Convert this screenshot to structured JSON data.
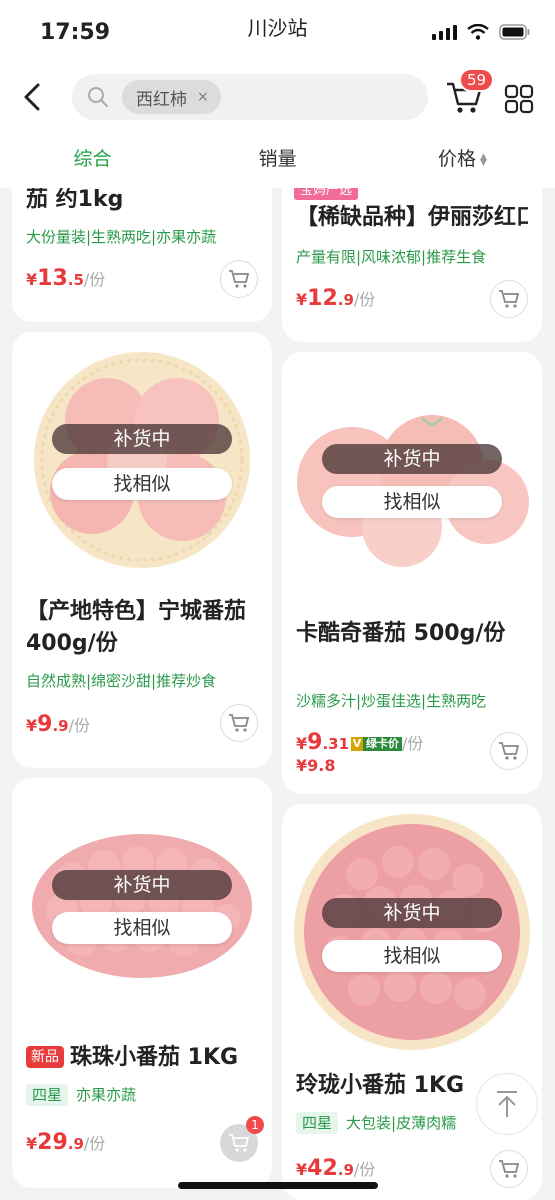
{
  "status_bar": {
    "time": "17:59",
    "station": "川沙站"
  },
  "header": {
    "search_tag": "西红柿",
    "search_tag_close": "×",
    "cart_count": "59"
  },
  "sort_tabs": [
    {
      "label": "综合",
      "active": true
    },
    {
      "label": "销量",
      "active": false
    },
    {
      "label": "价格",
      "active": false
    }
  ],
  "products": [
    {
      "title": "茄 约1kg",
      "features": "大份量装|生熟两吃|亦果亦蔬",
      "price_currency": "¥",
      "price_int": "13",
      "price_dec": ".5",
      "unit": "/份"
    },
    {
      "promo": "宝妈严选",
      "title": "【稀缺品种】伊丽莎红口感…",
      "features": "产量有限|风味浓郁|推荐生食",
      "price_currency": "¥",
      "price_int": "12",
      "price_dec": ".9",
      "unit": "/份"
    },
    {
      "restock": "补货中",
      "find_similar": "找相似",
      "title": "【产地特色】宁城番茄 400g/份",
      "features": "自然成熟|绵密沙甜|推荐炒食",
      "price_currency": "¥",
      "price_int": "9",
      "price_dec": ".9",
      "unit": "/份"
    },
    {
      "restock": "补货中",
      "find_similar": "找相似",
      "title": "卡酷奇番茄 500g/份",
      "features": "沙糯多汁|炒蛋佳选|生熟两吃",
      "price_currency": "¥",
      "price_int": "9",
      "price_dec": ".31",
      "v_tag": "V",
      "card_price_tag": "绿卡价",
      "unit": "/份",
      "original_price": "¥9.8"
    },
    {
      "restock": "补货中",
      "find_similar": "找相似",
      "new_tag": "新品",
      "title": "珠珠小番茄 1KG",
      "star_tag": "四星",
      "features": "亦果亦蔬",
      "price_currency": "¥",
      "price_int": "29",
      "price_dec": ".9",
      "unit": "/份",
      "cart_badge": "1"
    },
    {
      "restock": "补货中",
      "find_similar": "找相似",
      "title": "玲珑小番茄 1KG",
      "star_tag": "四星",
      "features": "大包装|皮薄肉糯",
      "price_currency": "¥",
      "price_int": "42",
      "price_dec": ".9",
      "unit": "/份"
    }
  ],
  "colors": {
    "accent_green": "#21a34a",
    "price_red": "#e8393b",
    "badge_red": "#f04a4a"
  }
}
